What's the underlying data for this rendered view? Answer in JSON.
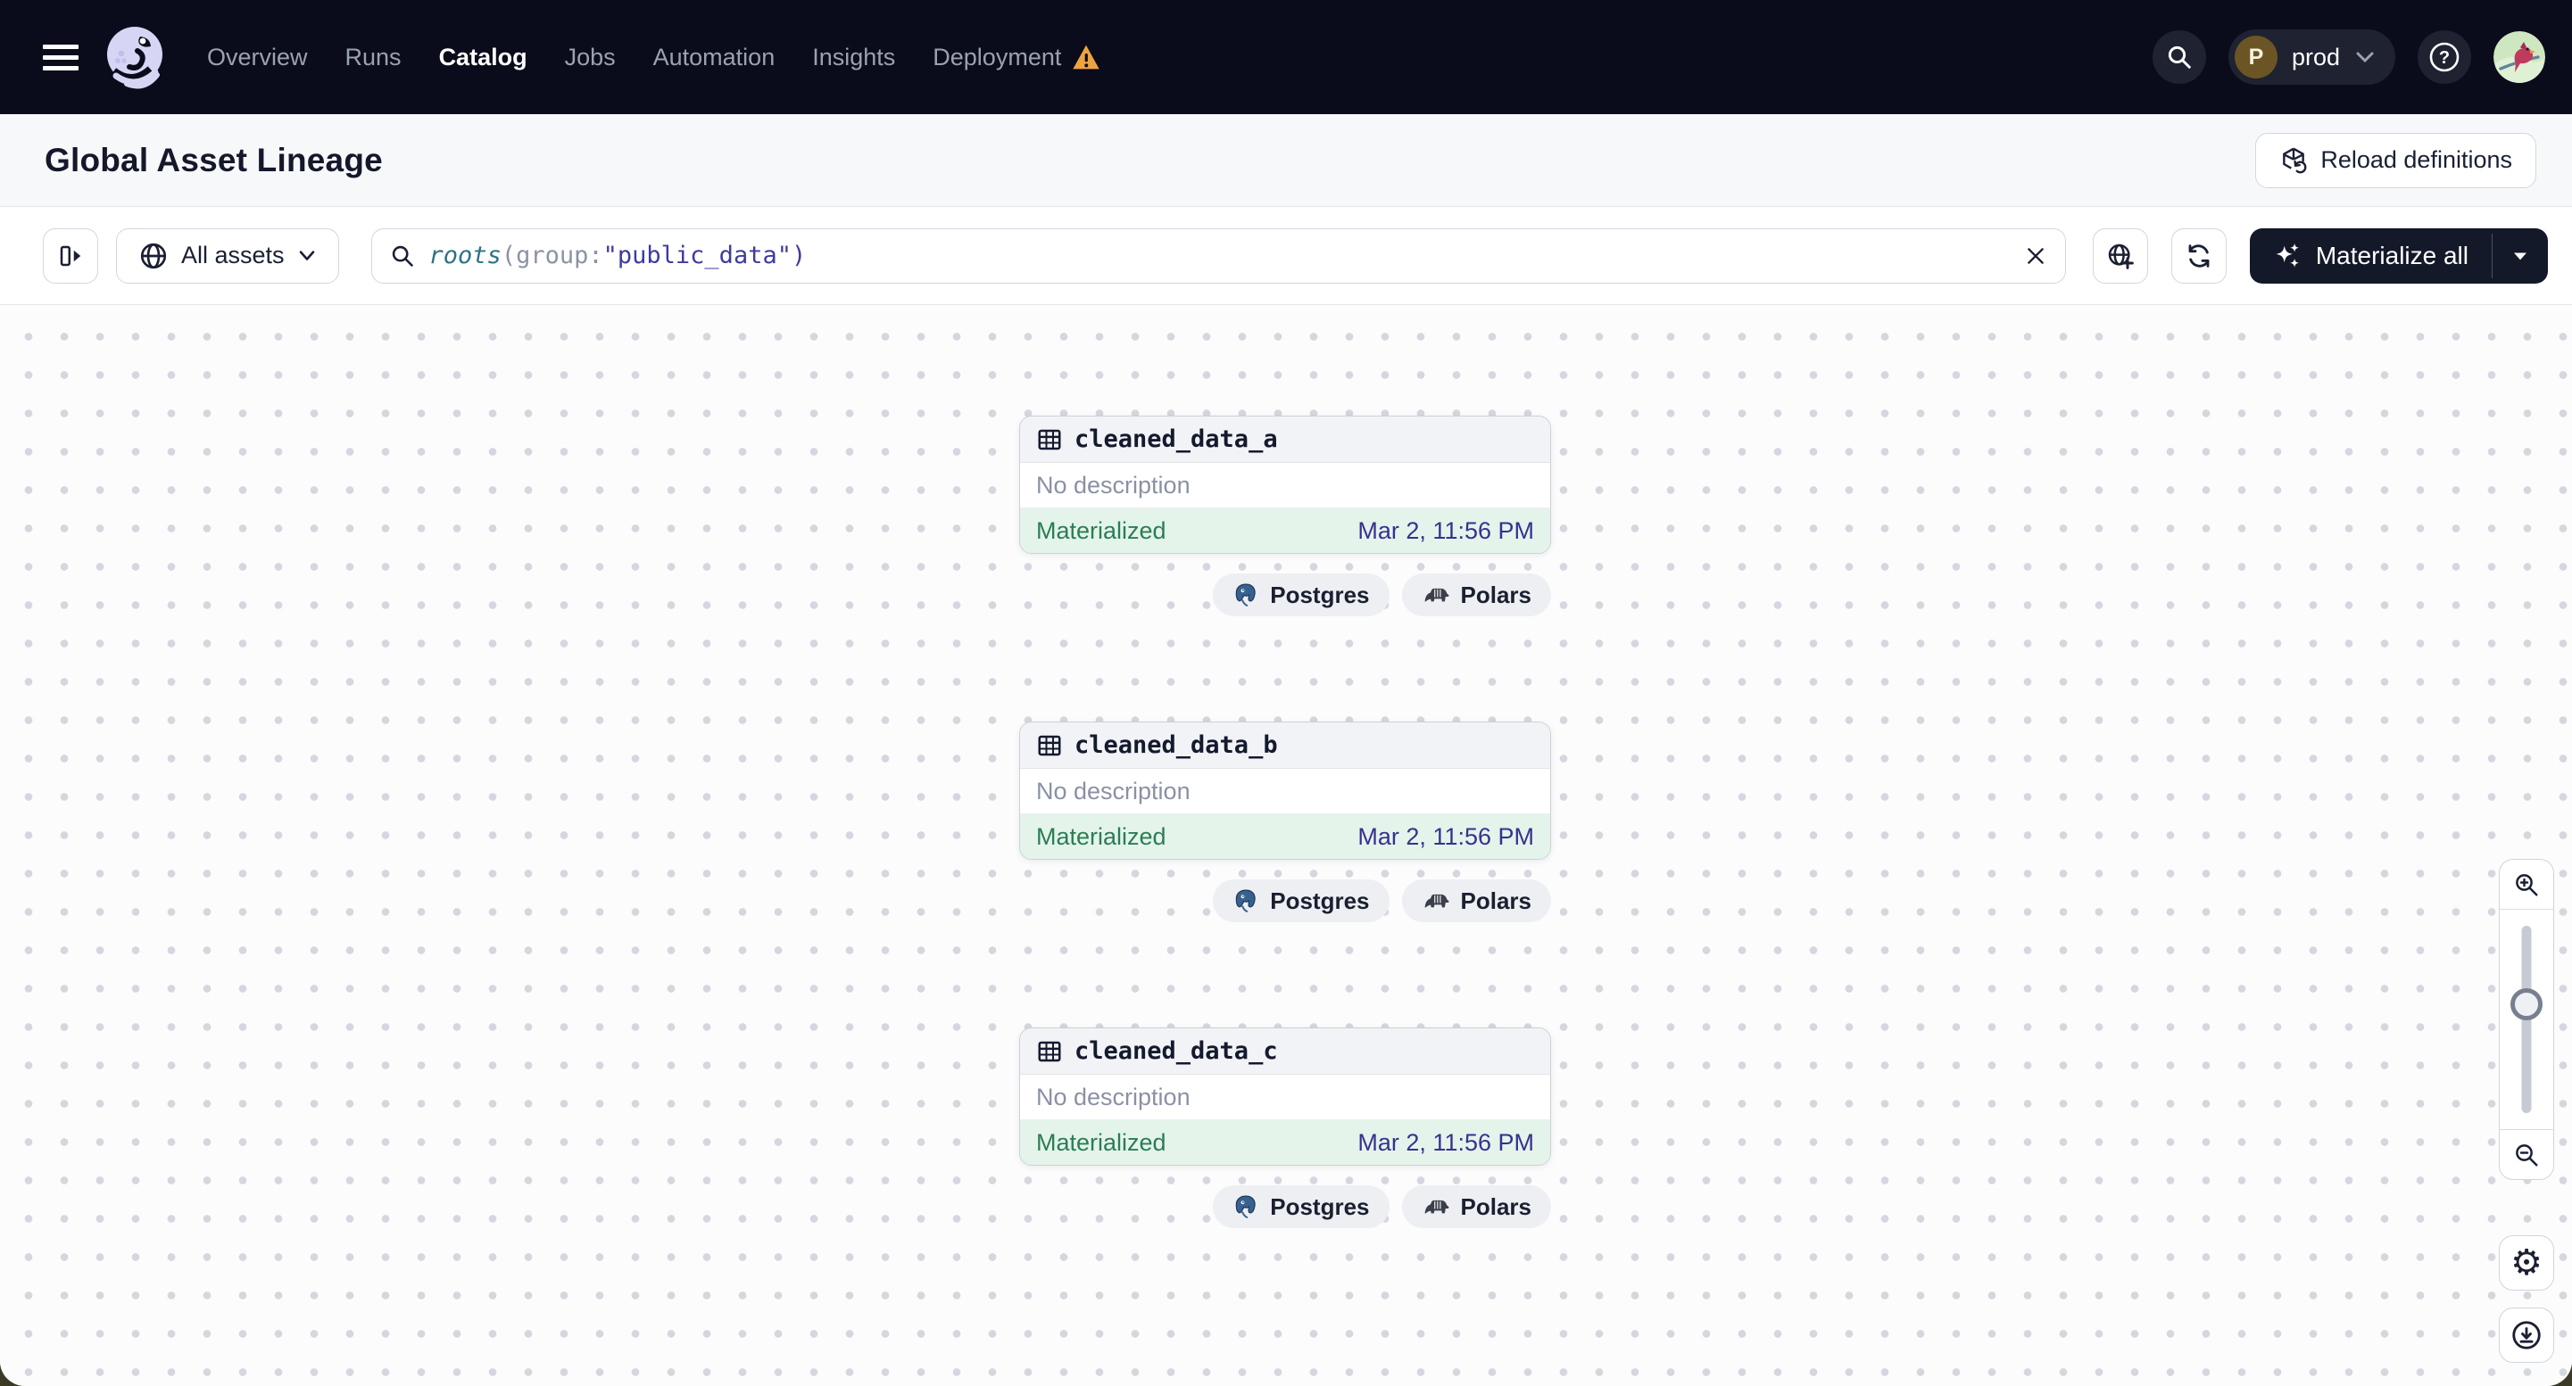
{
  "nav": {
    "items": [
      {
        "label": "Overview",
        "active": false
      },
      {
        "label": "Runs",
        "active": false
      },
      {
        "label": "Catalog",
        "active": true
      },
      {
        "label": "Jobs",
        "active": false
      },
      {
        "label": "Automation",
        "active": false
      },
      {
        "label": "Insights",
        "active": false
      },
      {
        "label": "Deployment",
        "active": false,
        "warning": true
      }
    ],
    "env": {
      "initial": "P",
      "name": "prod"
    },
    "help_glyph": "?"
  },
  "header": {
    "title": "Global Asset Lineage",
    "reload_label": "Reload definitions"
  },
  "toolbar": {
    "scope_label": "All assets",
    "query": {
      "fn": "roots",
      "p1": "(",
      "arg": "group:",
      "str": "\"public_data\"",
      "p2": ")"
    },
    "materialize_label": "Materialize all"
  },
  "assets": [
    {
      "name": "cleaned_data_a",
      "description": "No description",
      "status": "Materialized",
      "timestamp": "Mar 2, 11:56 PM",
      "tags": [
        {
          "label": "Postgres",
          "icon": "postgres-icon"
        },
        {
          "label": "Polars",
          "icon": "polars-icon"
        }
      ]
    },
    {
      "name": "cleaned_data_b",
      "description": "No description",
      "status": "Materialized",
      "timestamp": "Mar 2, 11:56 PM",
      "tags": [
        {
          "label": "Postgres",
          "icon": "postgres-icon"
        },
        {
          "label": "Polars",
          "icon": "polars-icon"
        }
      ]
    },
    {
      "name": "cleaned_data_c",
      "description": "No description",
      "status": "Materialized",
      "timestamp": "Mar 2, 11:56 PM",
      "tags": [
        {
          "label": "Postgres",
          "icon": "postgres-icon"
        },
        {
          "label": "Polars",
          "icon": "polars-icon"
        }
      ]
    }
  ],
  "colors": {
    "nav_bg": "#0a0c1b",
    "brand_lavender": "#d7d5f4",
    "warning": "#eda33e",
    "materialized_green": "#2b7d53",
    "materialized_bg": "#e4f4ea",
    "timestamp_indigo": "#38318f",
    "query_fn_teal": "#2f7286",
    "query_string_indigo": "#3f3aa0"
  }
}
